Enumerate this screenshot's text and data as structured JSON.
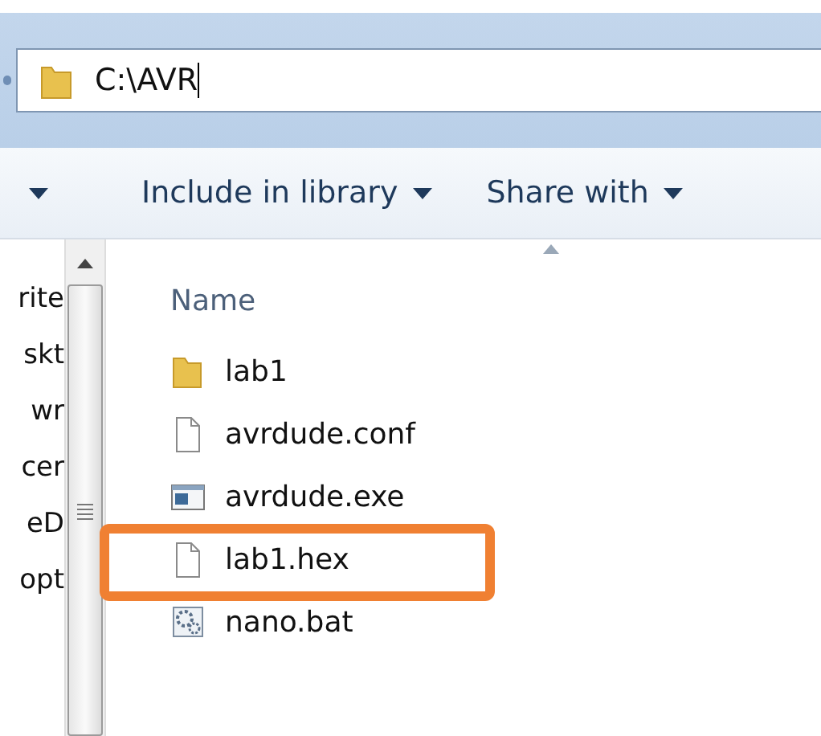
{
  "address_bar": {
    "value": "C:\\AVR"
  },
  "toolbar": {
    "items": [
      {
        "label": "Include in library"
      },
      {
        "label": "Share with"
      }
    ]
  },
  "navigation": {
    "items": [
      "rite",
      "skt",
      "wr",
      "cer",
      "eD",
      "opt"
    ]
  },
  "file_list": {
    "column": "Name",
    "files": [
      {
        "name": "lab1",
        "kind": "folder",
        "highlighted": false
      },
      {
        "name": "avrdude.conf",
        "kind": "file",
        "highlighted": false
      },
      {
        "name": "avrdude.exe",
        "kind": "program",
        "highlighted": false
      },
      {
        "name": "lab1.hex",
        "kind": "file",
        "highlighted": true
      },
      {
        "name": "nano.bat",
        "kind": "batch",
        "highlighted": false
      }
    ]
  }
}
